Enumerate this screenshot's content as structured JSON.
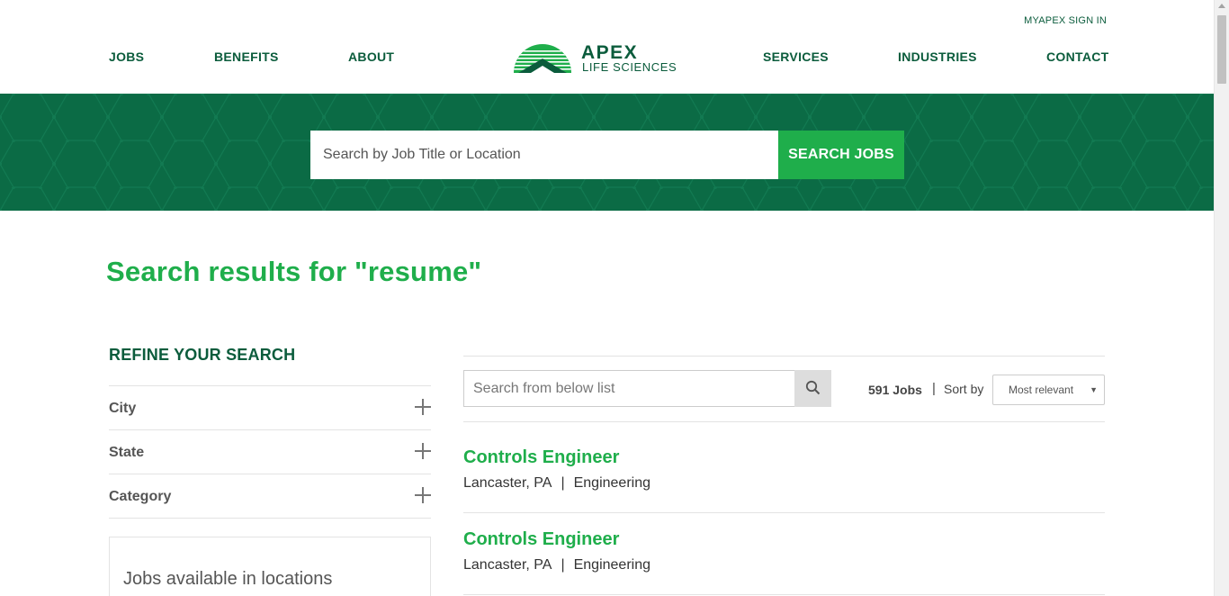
{
  "header": {
    "signin": "MYAPEX SIGN IN",
    "nav_left": [
      "JOBS",
      "BENEFITS",
      "ABOUT"
    ],
    "nav_right": [
      "SERVICES",
      "INDUSTRIES",
      "CONTACT"
    ],
    "logo_line1": "APEX",
    "logo_line2": "LIFE SCIENCES"
  },
  "hero": {
    "search_placeholder": "Search by Job Title or Location",
    "search_button": "SEARCH JOBS"
  },
  "page_title": "Search results for \"resume\"",
  "refine": {
    "title": "REFINE YOUR SEARCH",
    "facets": [
      "City",
      "State",
      "Category"
    ],
    "locations_box": "Jobs available in locations"
  },
  "results": {
    "list_search_placeholder": "Search from below list",
    "count": "591 Jobs",
    "separator": "|",
    "sort_label": "Sort by",
    "sort_value": "Most relevant",
    "jobs": [
      {
        "title": "Controls Engineer",
        "location": "Lancaster, PA",
        "category": "Engineering"
      },
      {
        "title": "Controls Engineer",
        "location": "Lancaster, PA",
        "category": "Engineering"
      }
    ]
  },
  "colors": {
    "brand_dark": "#0b5c3c",
    "brand_green": "#1fae4b",
    "hero_bg": "#0b6b45"
  }
}
